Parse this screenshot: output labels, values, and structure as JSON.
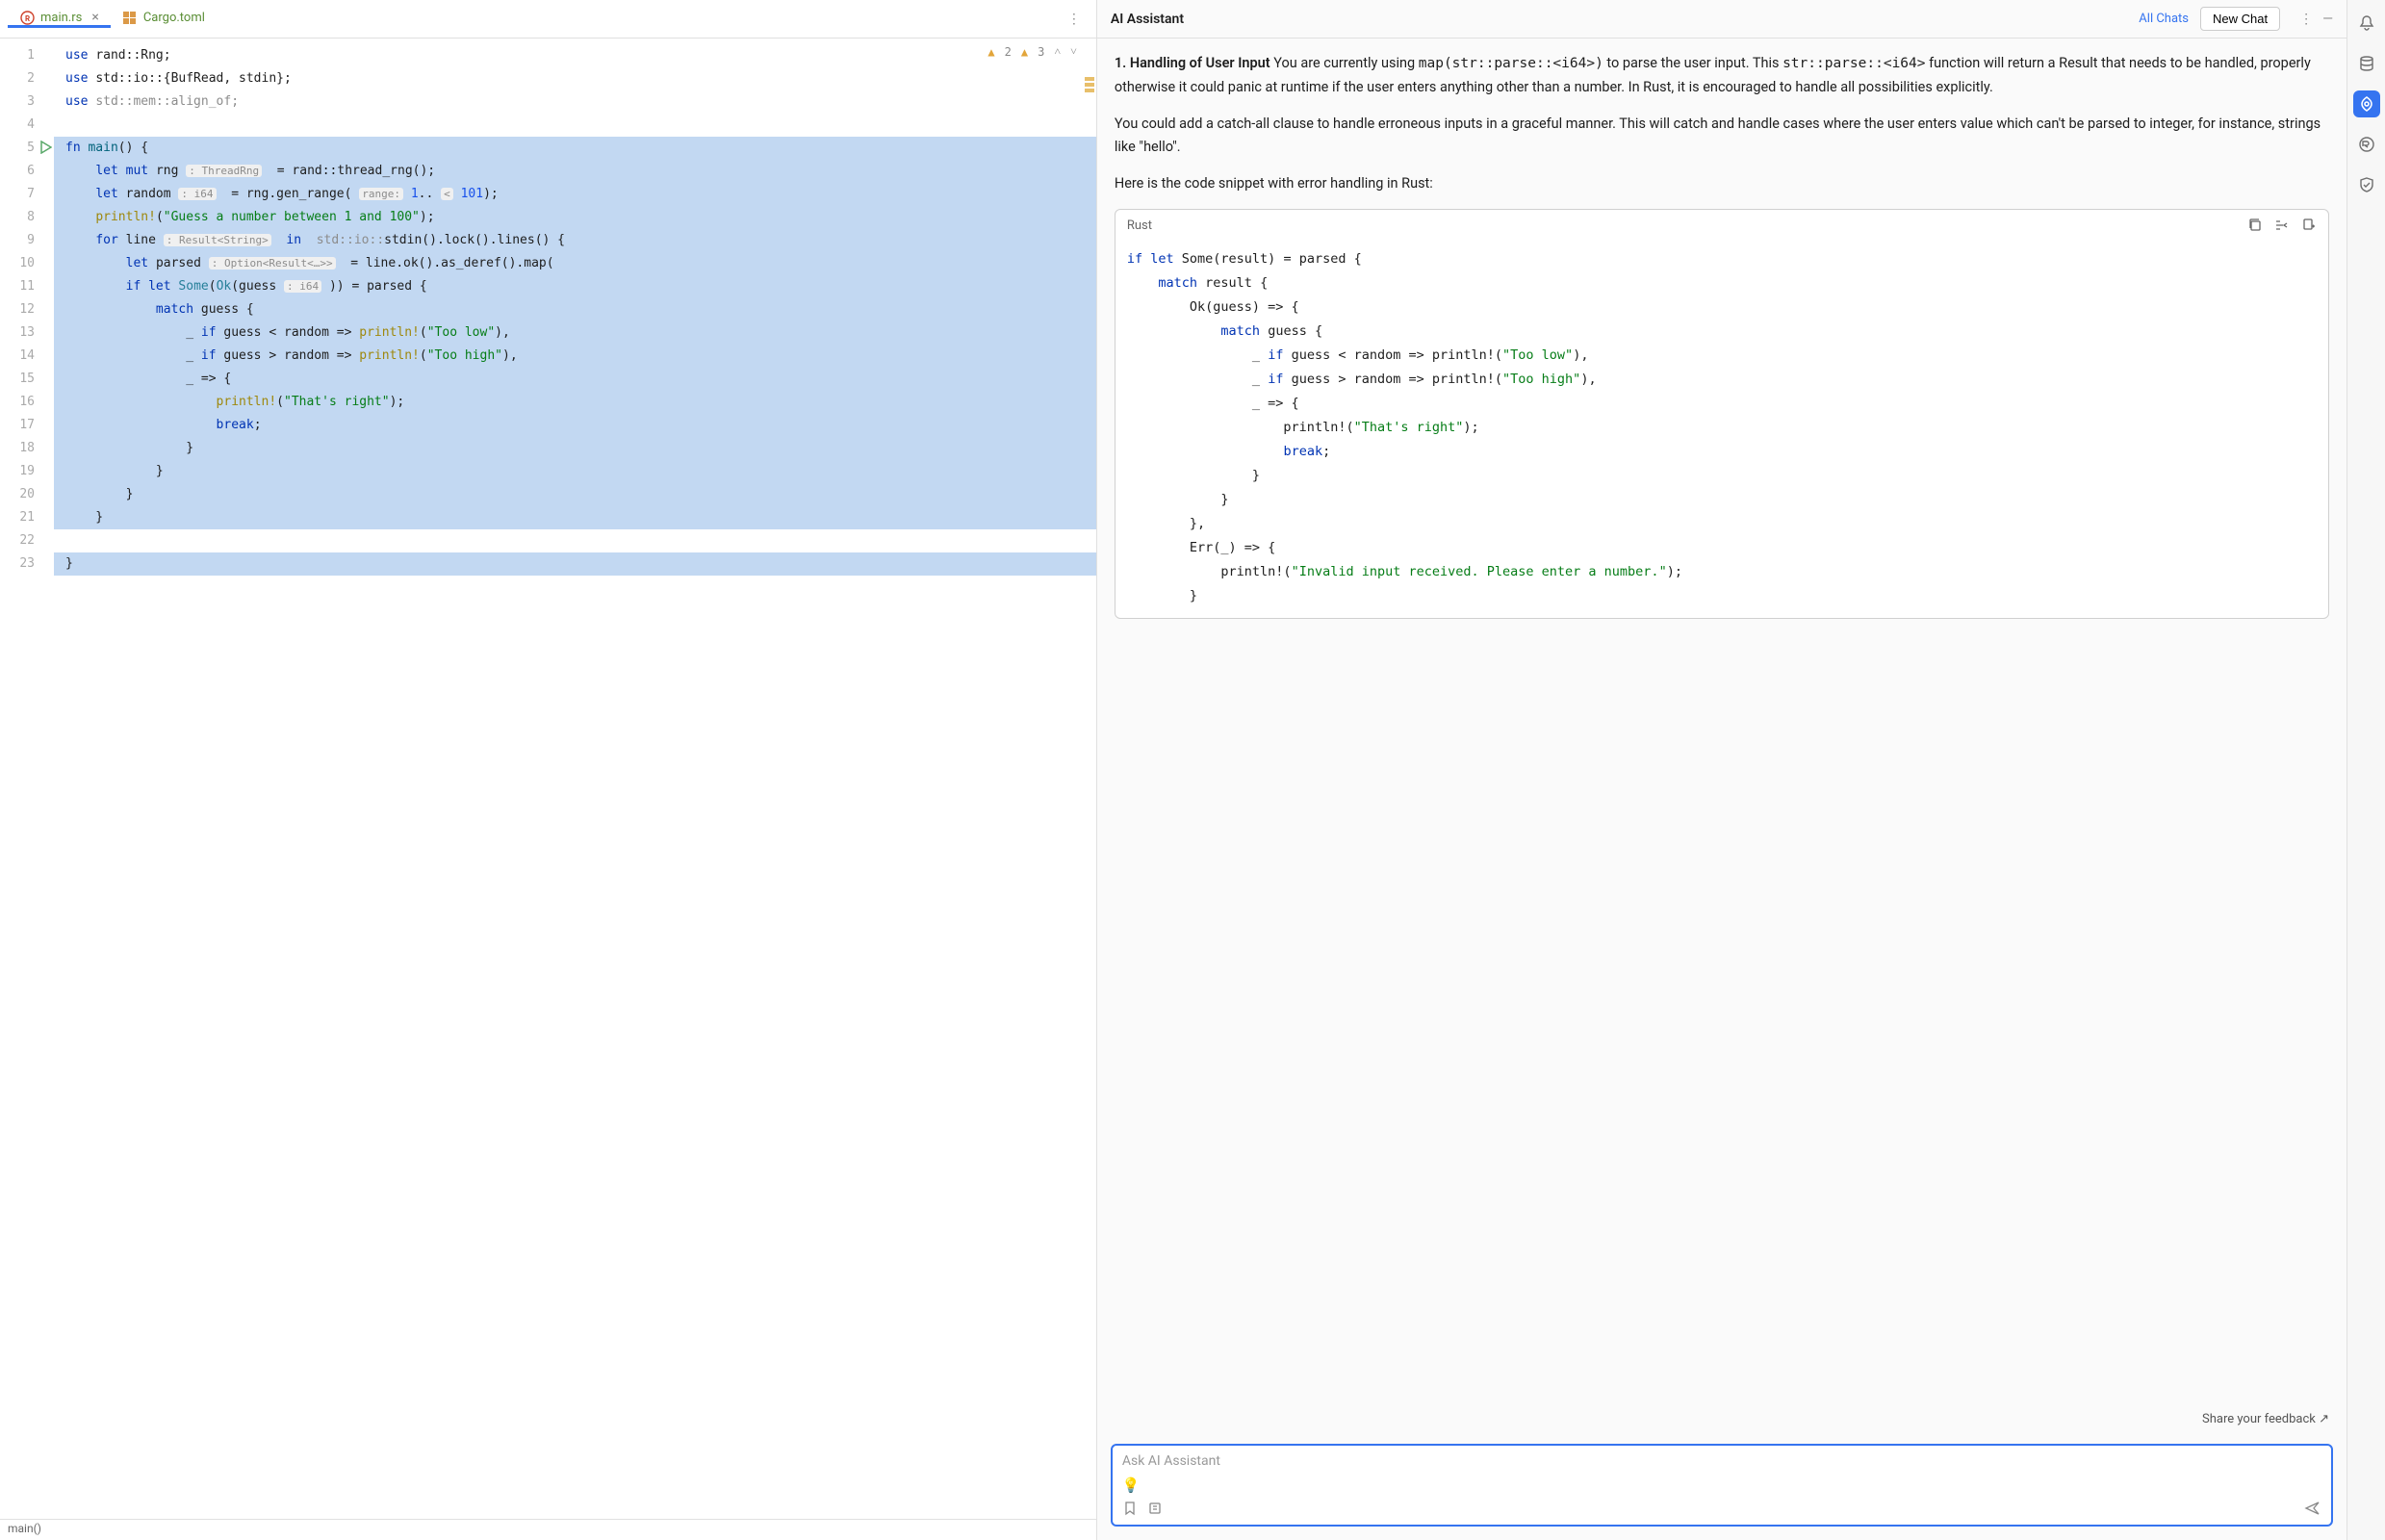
{
  "tabs": [
    {
      "label": "main.rs",
      "icon": "rust",
      "active": true
    },
    {
      "label": "Cargo.toml",
      "icon": "cargo",
      "active": false
    }
  ],
  "warnings": {
    "count1": "2",
    "count2": "3"
  },
  "line_count": 23,
  "run_marker_line": 5,
  "code_lines": [
    {
      "n": 1,
      "sel": false,
      "tokens": [
        {
          "t": "use ",
          "c": "kw"
        },
        {
          "t": "rand::Rng;",
          "c": ""
        }
      ]
    },
    {
      "n": 2,
      "sel": false,
      "tokens": [
        {
          "t": "use ",
          "c": "kw"
        },
        {
          "t": "std::io::{BufRead, stdin};",
          "c": ""
        }
      ]
    },
    {
      "n": 3,
      "sel": false,
      "tokens": [
        {
          "t": "use ",
          "c": "kw"
        },
        {
          "t": "std::mem::align_of;",
          "c": "cm"
        }
      ]
    },
    {
      "n": 4,
      "sel": false,
      "tokens": []
    },
    {
      "n": 5,
      "sel": true,
      "tokens": [
        {
          "t": "fn ",
          "c": "kw"
        },
        {
          "t": "main",
          "c": "fn"
        },
        {
          "t": "() {",
          "c": ""
        }
      ]
    },
    {
      "n": 6,
      "sel": true,
      "tokens": [
        {
          "t": "    ",
          "c": ""
        },
        {
          "t": "let mut ",
          "c": "kw"
        },
        {
          "t": "rng ",
          "c": ""
        },
        {
          "t": ": ThreadRng",
          "c": "hint"
        },
        {
          "t": "  = rand::thread_rng();",
          "c": ""
        }
      ]
    },
    {
      "n": 7,
      "sel": true,
      "tokens": [
        {
          "t": "    ",
          "c": ""
        },
        {
          "t": "let ",
          "c": "kw"
        },
        {
          "t": "random ",
          "c": ""
        },
        {
          "t": ": i64",
          "c": "hint"
        },
        {
          "t": "  = rng.gen_range( ",
          "c": ""
        },
        {
          "t": "range:",
          "c": "hint"
        },
        {
          "t": " ",
          "c": ""
        },
        {
          "t": "1",
          "c": "num"
        },
        {
          "t": ".. ",
          "c": ""
        },
        {
          "t": "<",
          "c": "hint"
        },
        {
          "t": " ",
          "c": ""
        },
        {
          "t": "101",
          "c": "num"
        },
        {
          "t": ");",
          "c": ""
        }
      ]
    },
    {
      "n": 8,
      "sel": true,
      "tokens": [
        {
          "t": "    ",
          "c": ""
        },
        {
          "t": "println!",
          "c": "mac"
        },
        {
          "t": "(",
          "c": ""
        },
        {
          "t": "\"Guess a number between 1 and 100\"",
          "c": "str"
        },
        {
          "t": ");",
          "c": ""
        }
      ]
    },
    {
      "n": 9,
      "sel": true,
      "tokens": [
        {
          "t": "    ",
          "c": ""
        },
        {
          "t": "for ",
          "c": "kw"
        },
        {
          "t": "line ",
          "c": ""
        },
        {
          "t": ": Result<String>",
          "c": "hint"
        },
        {
          "t": "  ",
          "c": ""
        },
        {
          "t": "in ",
          "c": "kw"
        },
        {
          "t": " std::io::",
          "c": "cm"
        },
        {
          "t": "stdin().lock().lines() {",
          "c": ""
        }
      ]
    },
    {
      "n": 10,
      "sel": true,
      "tokens": [
        {
          "t": "        ",
          "c": ""
        },
        {
          "t": "let ",
          "c": "kw"
        },
        {
          "t": "parsed ",
          "c": ""
        },
        {
          "t": ": Option<Result<…>>",
          "c": "hint"
        },
        {
          "t": "  = line.ok().as_deref().map(",
          "c": ""
        }
      ]
    },
    {
      "n": 11,
      "sel": true,
      "tokens": [
        {
          "t": "        ",
          "c": ""
        },
        {
          "t": "if let ",
          "c": "kw"
        },
        {
          "t": "Some",
          "c": "ty"
        },
        {
          "t": "(",
          "c": ""
        },
        {
          "t": "Ok",
          "c": "ty"
        },
        {
          "t": "(guess ",
          "c": ""
        },
        {
          "t": ": i64",
          "c": "hint"
        },
        {
          "t": " )) = parsed {",
          "c": ""
        }
      ]
    },
    {
      "n": 12,
      "sel": true,
      "tokens": [
        {
          "t": "            ",
          "c": ""
        },
        {
          "t": "match ",
          "c": "kw"
        },
        {
          "t": "guess {",
          "c": ""
        }
      ]
    },
    {
      "n": 13,
      "sel": true,
      "tokens": [
        {
          "t": "                _ ",
          "c": ""
        },
        {
          "t": "if ",
          "c": "kw"
        },
        {
          "t": "guess < random => ",
          "c": ""
        },
        {
          "t": "println!",
          "c": "mac"
        },
        {
          "t": "(",
          "c": ""
        },
        {
          "t": "\"Too low\"",
          "c": "str"
        },
        {
          "t": "),",
          "c": ""
        }
      ]
    },
    {
      "n": 14,
      "sel": true,
      "tokens": [
        {
          "t": "                _ ",
          "c": ""
        },
        {
          "t": "if ",
          "c": "kw"
        },
        {
          "t": "guess > random => ",
          "c": ""
        },
        {
          "t": "println!",
          "c": "mac"
        },
        {
          "t": "(",
          "c": ""
        },
        {
          "t": "\"Too high\"",
          "c": "str"
        },
        {
          "t": "),",
          "c": ""
        }
      ]
    },
    {
      "n": 15,
      "sel": true,
      "tokens": [
        {
          "t": "                _ => {",
          "c": ""
        }
      ]
    },
    {
      "n": 16,
      "sel": true,
      "tokens": [
        {
          "t": "                    ",
          "c": ""
        },
        {
          "t": "println!",
          "c": "mac"
        },
        {
          "t": "(",
          "c": ""
        },
        {
          "t": "\"That's right\"",
          "c": "str"
        },
        {
          "t": ");",
          "c": ""
        }
      ]
    },
    {
      "n": 17,
      "sel": true,
      "tokens": [
        {
          "t": "                    ",
          "c": ""
        },
        {
          "t": "break",
          "c": "kw"
        },
        {
          "t": ";",
          "c": ""
        }
      ]
    },
    {
      "n": 18,
      "sel": true,
      "tokens": [
        {
          "t": "                }",
          "c": ""
        }
      ]
    },
    {
      "n": 19,
      "sel": true,
      "tokens": [
        {
          "t": "            }",
          "c": ""
        }
      ]
    },
    {
      "n": 20,
      "sel": true,
      "tokens": [
        {
          "t": "        }",
          "c": ""
        }
      ]
    },
    {
      "n": 21,
      "sel": true,
      "tokens": [
        {
          "t": "    }",
          "c": ""
        }
      ]
    },
    {
      "n": 22,
      "sel": false,
      "tokens": []
    },
    {
      "n": 23,
      "sel": true,
      "tokens": [
        {
          "t": "}",
          "c": ""
        }
      ]
    }
  ],
  "breadcrumb": "main()",
  "ai": {
    "title": "AI Assistant",
    "all_chats": "All Chats",
    "new_chat": "New Chat",
    "p1_bold": "1. Handling of User Input",
    "p1_a": " You are currently using ",
    "p1_code1": "map(str::parse::<i64>)",
    "p1_b": " to parse the user input. This ",
    "p1_code2": "str::parse::<i64>",
    "p1_c": " function will return a Result that needs to be handled, properly otherwise it could panic at runtime if the user enters anything other than a number. In Rust, it is encouraged to handle all possibilities explicitly.",
    "p2": "You could add a catch-all clause to handle erroneous inputs in a graceful manner. This will catch and handle cases where the user enters value which can't be parsed to integer, for instance, strings like \"hello\".",
    "p3": "Here is the code snippet with error handling in Rust:",
    "code_lang": "Rust",
    "snippet_lines": [
      [
        {
          "t": "if let ",
          "c": "kw"
        },
        {
          "t": "Some(result) = parsed {",
          "c": ""
        }
      ],
      [
        {
          "t": "    ",
          "c": ""
        },
        {
          "t": "match ",
          "c": "kw"
        },
        {
          "t": "result {",
          "c": ""
        }
      ],
      [
        {
          "t": "        Ok(guess) => {",
          "c": ""
        }
      ],
      [
        {
          "t": "            ",
          "c": ""
        },
        {
          "t": "match ",
          "c": "kw"
        },
        {
          "t": "guess {",
          "c": ""
        }
      ],
      [
        {
          "t": "                _ ",
          "c": ""
        },
        {
          "t": "if ",
          "c": "kw"
        },
        {
          "t": "guess < random => println!(",
          "c": ""
        },
        {
          "t": "\"Too low\"",
          "c": "str"
        },
        {
          "t": "),",
          "c": ""
        }
      ],
      [
        {
          "t": "                _ ",
          "c": ""
        },
        {
          "t": "if ",
          "c": "kw"
        },
        {
          "t": "guess > random => println!(",
          "c": ""
        },
        {
          "t": "\"Too high\"",
          "c": "str"
        },
        {
          "t": "),",
          "c": ""
        }
      ],
      [
        {
          "t": "                _ => {",
          "c": ""
        }
      ],
      [
        {
          "t": "                    println!(",
          "c": ""
        },
        {
          "t": "\"That's right\"",
          "c": "str"
        },
        {
          "t": ");",
          "c": ""
        }
      ],
      [
        {
          "t": "                    ",
          "c": ""
        },
        {
          "t": "break",
          "c": "kw"
        },
        {
          "t": ";",
          "c": ""
        }
      ],
      [
        {
          "t": "                }",
          "c": ""
        }
      ],
      [
        {
          "t": "            }",
          "c": ""
        }
      ],
      [
        {
          "t": "        },",
          "c": ""
        }
      ],
      [
        {
          "t": "        Err(_) => {",
          "c": ""
        }
      ],
      [
        {
          "t": "            println!(",
          "c": ""
        },
        {
          "t": "\"Invalid input received. Please enter a number.\"",
          "c": "str"
        },
        {
          "t": ");",
          "c": ""
        }
      ],
      [
        {
          "t": "        }",
          "c": ""
        }
      ]
    ],
    "feedback": "Share your feedback ↗",
    "placeholder": "Ask AI Assistant"
  }
}
